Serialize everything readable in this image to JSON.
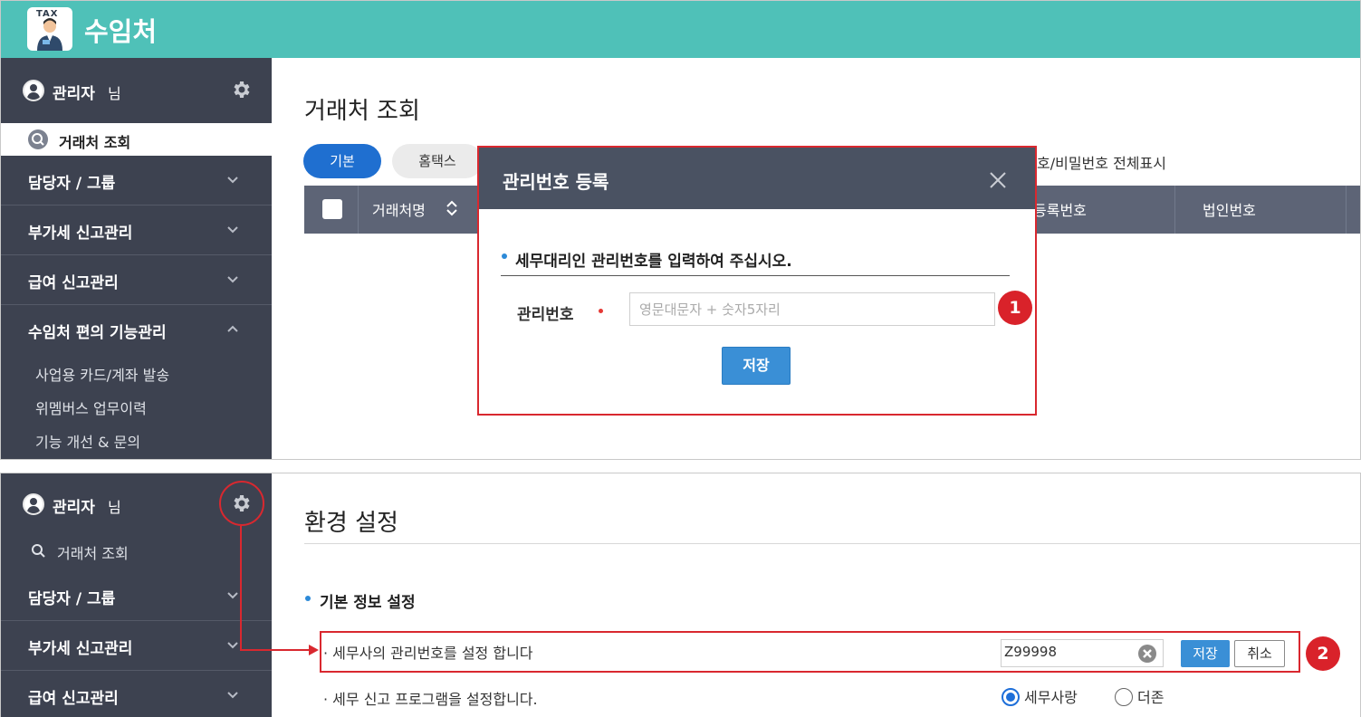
{
  "app": {
    "title": "수임처",
    "logo_tag": "TAX"
  },
  "top": {
    "user": {
      "name": "관리자",
      "suffix": "님"
    },
    "menu_active": "거래처 조회",
    "menu": [
      "담당자 / 그룹",
      "부가세 신고관리",
      "급여 신고관리",
      "수임처 편의 기능관리"
    ],
    "submenu": [
      "사업용 카드/계좌 발송",
      "위멤버스 업무이력",
      "기능 개선 & 문의"
    ],
    "page_title": "거래처 조회",
    "tabs": [
      "기본",
      "홈택스"
    ],
    "show_all_text": "호/비밀번호 전체표시",
    "grid": {
      "col_name": "거래처명",
      "col_reg": "등록번호",
      "col_corp": "법인번호"
    },
    "modal": {
      "title": "관리번호 등록",
      "instruction": "세무대리인 관리번호를 입력하여 주십시오.",
      "field_label": "관리번호",
      "placeholder": "영문대문자 + 숫자5자리",
      "save": "저장"
    },
    "marker": "1"
  },
  "bottom": {
    "user": {
      "name": "관리자",
      "suffix": "님"
    },
    "menu_search": "거래처 조회",
    "menu": [
      "담당자 / 그룹",
      "부가세 신고관리",
      "급여 신고관리"
    ],
    "page_title": "환경 설정",
    "section_title": "기본 정보 설정",
    "row1": {
      "label": "· 세무사의 관리번호를 설정 합니다",
      "value": "Z99998",
      "save": "저장",
      "cancel": "취소"
    },
    "row2": {
      "label": "· 세무 신고 프로그램을 설정합니다.",
      "options": [
        "세무사랑",
        "더존"
      ],
      "selected": "세무사랑"
    },
    "marker": "2"
  },
  "colors": {
    "header": "#4fc1b8",
    "sidebar": "#3d4250",
    "accent": "#1f6fd0",
    "highlight": "#d9282f"
  },
  "icons": [
    "gear-icon",
    "search-icon",
    "chevron-down-icon",
    "chevron-up-icon",
    "close-icon",
    "sort-icon",
    "clear-icon",
    "avatar-icon"
  ]
}
